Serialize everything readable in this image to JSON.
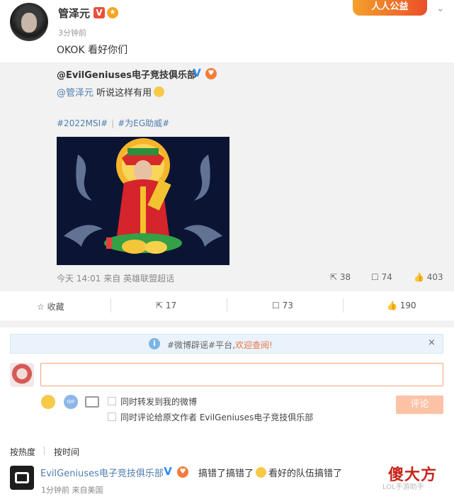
{
  "post": {
    "author": "管泽元",
    "time": "3分钟前",
    "text": "OKOK 看好你们",
    "gongyi_badge": "人人公益",
    "v_badge": "V"
  },
  "repost": {
    "author": "@EvilGeniuses电子竞技俱乐部",
    "mention": "@管泽元",
    "text": " 听说这样有用",
    "tag1": "#2022MSI#",
    "tag2": "#为EG助威#",
    "time": "今天 14:01",
    "source_prefix": "来自",
    "source": "英雄联盟超话",
    "reposts": "38",
    "comments": "74",
    "likes": "403",
    "image_alt_icon": "god-of-wealth-image"
  },
  "actions": {
    "collect": "收藏",
    "repost": "17",
    "comment": "73",
    "like": "190"
  },
  "notice": {
    "text": "#微博辟谣#平台,",
    "link": "欢迎查阅!",
    "close": "×"
  },
  "composer": {
    "placeholder": "",
    "check1": "同时转发到我的微博",
    "check2": "同时评论给原文作者 EvilGeniuses电子竞技俱乐部",
    "submit": "评论",
    "gif": "GIF"
  },
  "sort": {
    "hot": "按热度",
    "time": "按时间"
  },
  "comment": {
    "author": "EvilGeniuses电子竞技俱乐部",
    "text": "搞错了搞错了",
    "text2": "看好的队伍搞错了",
    "time": "1分钟前",
    "location": "来自美国"
  },
  "watermark": {
    "text": "傻大方",
    "sub": "LOL手游助手"
  },
  "colors": {
    "link": "#507daf",
    "accent": "#eb7340",
    "submit_disabled": "#fbc2a6"
  }
}
